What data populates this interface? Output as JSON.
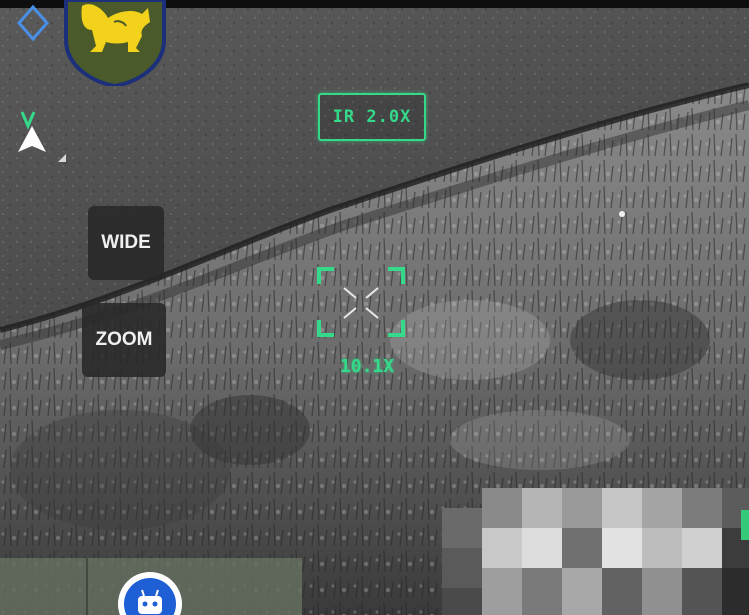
{
  "hud": {
    "camera_mode": "IR 2.0X",
    "zoom_readout": "10.1X",
    "wide_label": "WIDE",
    "zoom_label": "ZOOM"
  },
  "colors": {
    "hud_green": "#35d98a",
    "emblem_yellow": "#f2d21a",
    "emblem_shield": "#4a5a2a",
    "emblem_border": "#1c2f7a",
    "bottom_panel": "#646e5f",
    "app_button_blue": "#1f5fd6"
  },
  "icons": {
    "emblem": "lion-shield-icon",
    "diamond": "diamond-marker-icon",
    "north": "north-arrow-icon",
    "signal": "signal-icon",
    "app": "robot-icon"
  }
}
